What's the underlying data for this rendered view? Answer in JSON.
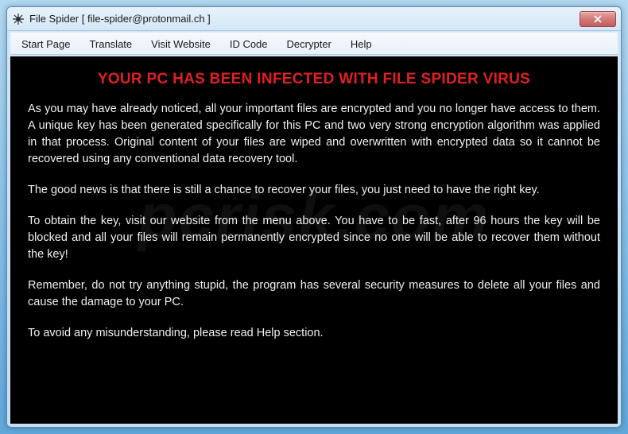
{
  "window": {
    "title": "File Spider [ file-spider@protonmail.ch ]"
  },
  "menu": {
    "items": [
      "Start Page",
      "Translate",
      "Visit Website",
      "ID Code",
      "Decrypter",
      "Help"
    ]
  },
  "content": {
    "headline": "YOUR PC HAS BEEN INFECTED WITH FILE SPIDER VIRUS",
    "paragraphs": [
      "As you may have already noticed, all your important files are encrypted and you no longer have access to them. A unique key has been generated specifically for this PC and two very strong encryption algorithm was applied in that process. Original content of your files are wiped and overwritten with encrypted data so it cannot be recovered using any conventional data recovery tool.",
      "The good news is that there is still a chance to recover your files, you just need to have the right key.",
      "To obtain the key, visit our website from the menu above. You have to be fast, after 96 hours the key will be blocked and all your files will remain permanently encrypted since no one will be able to recover them without the key!",
      "Remember, do not try anything stupid, the program has several security measures to delete all your files and cause the damage to your PC.",
      "To avoid any misunderstanding, please read Help section."
    ]
  },
  "watermark": "pcrisk.com"
}
